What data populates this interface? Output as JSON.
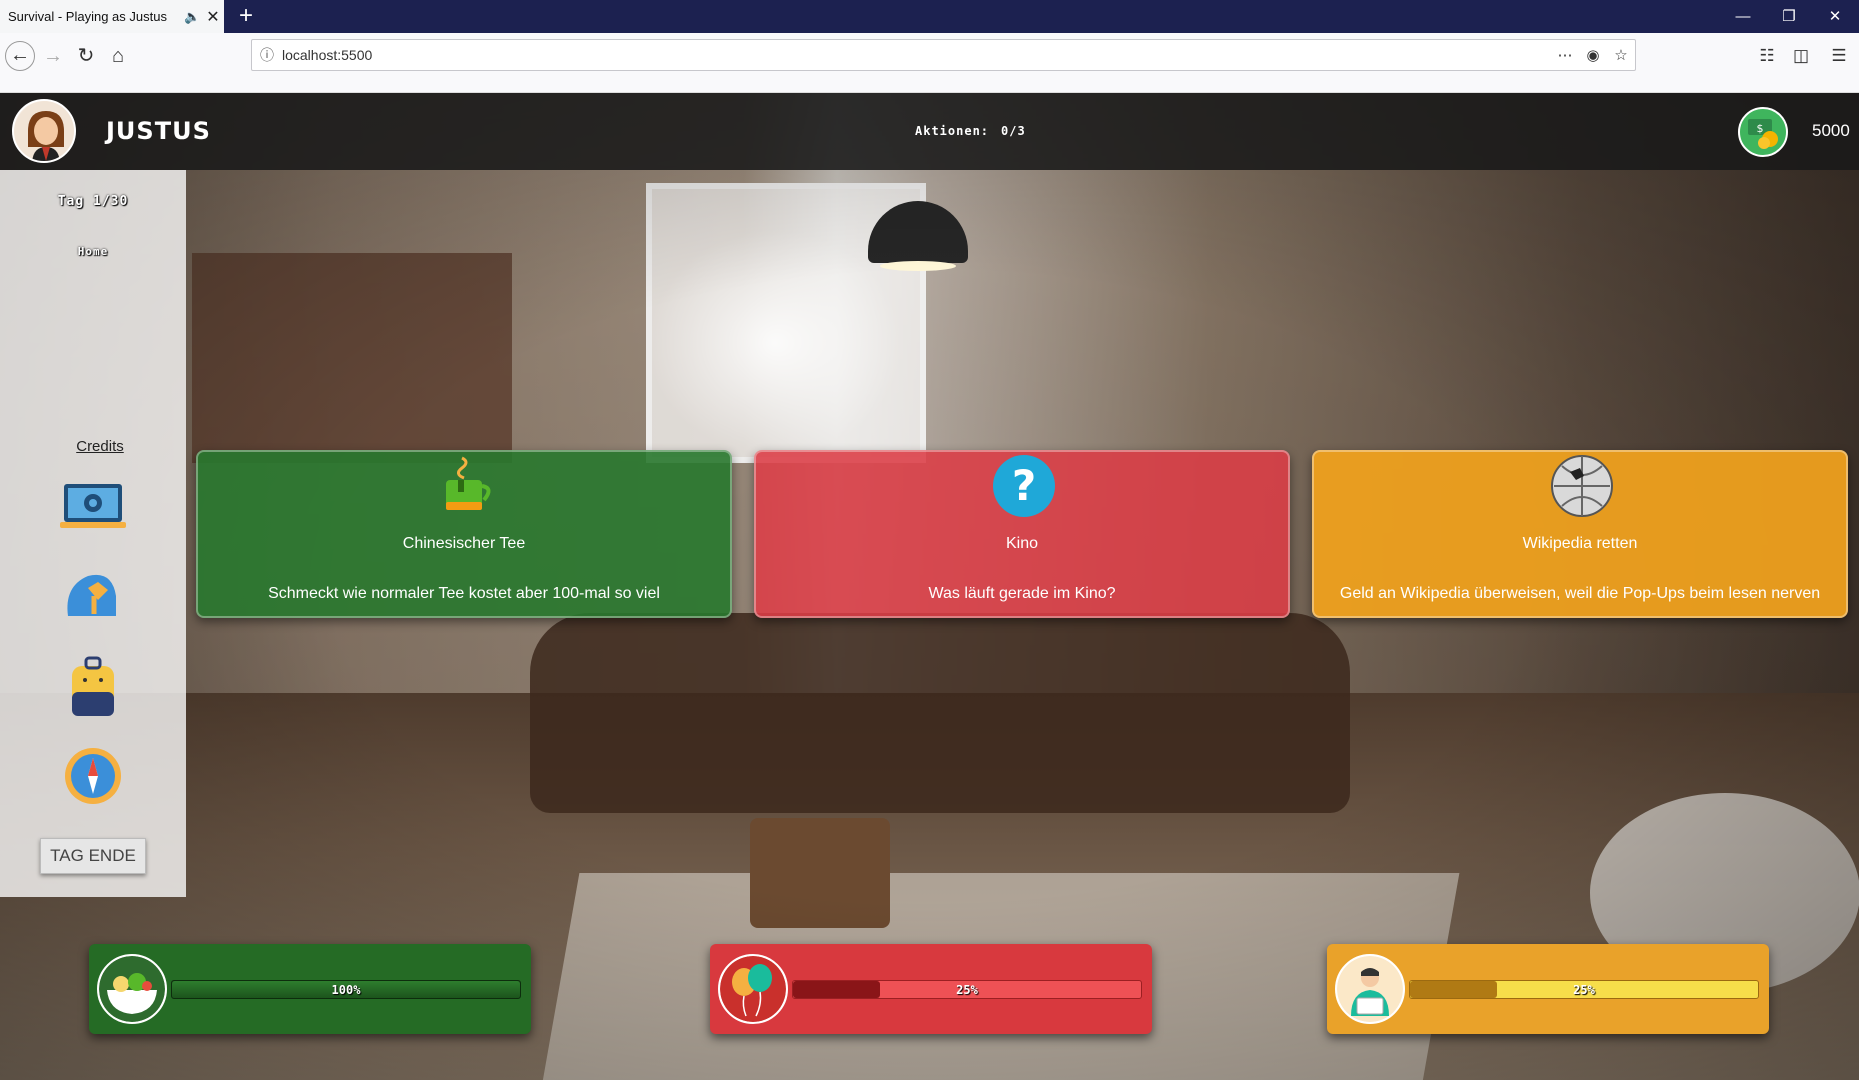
{
  "browser": {
    "tab_title": "Survival - Playing as Justus",
    "url": "localhost:5500"
  },
  "header": {
    "player_name": "Justus",
    "actions_label": "Aktionen:",
    "actions_value": "0/3",
    "money": "5000"
  },
  "sidebar": {
    "day": "Tag 1/30",
    "location": "Home",
    "credits": "Credits",
    "end_day_button": "TAG ENDE",
    "icons": [
      "laptop-settings-icon",
      "brain-network-icon",
      "backpack-icon",
      "compass-pin-icon"
    ]
  },
  "cards": [
    {
      "title": "Chinesischer Tee",
      "description": "Schmeckt wie normaler Tee kostet aber 100-mal so viel",
      "icon": "tea-cup-icon",
      "color": "#2a782d"
    },
    {
      "title": "Kino",
      "description": "Was läuft gerade im Kino?",
      "icon": "question-mark-icon",
      "color": "#dc3c46"
    },
    {
      "title": "Wikipedia retten",
      "description": "Geld an Wikipedia überweisen, weil die Pop-Ups beim lesen nerven",
      "icon": "wikipedia-globe-icon",
      "color": "#eea01e"
    }
  ],
  "stats": [
    {
      "label": "100%",
      "value": 1.0,
      "icon": "food-bowl-icon",
      "color": "#256b25"
    },
    {
      "label": "25%",
      "value": 0.25,
      "icon": "balloons-icon",
      "color": "#d8393e"
    },
    {
      "label": "25%",
      "value": 0.25,
      "icon": "worker-laptop-icon",
      "color": "#e9a22a"
    }
  ]
}
